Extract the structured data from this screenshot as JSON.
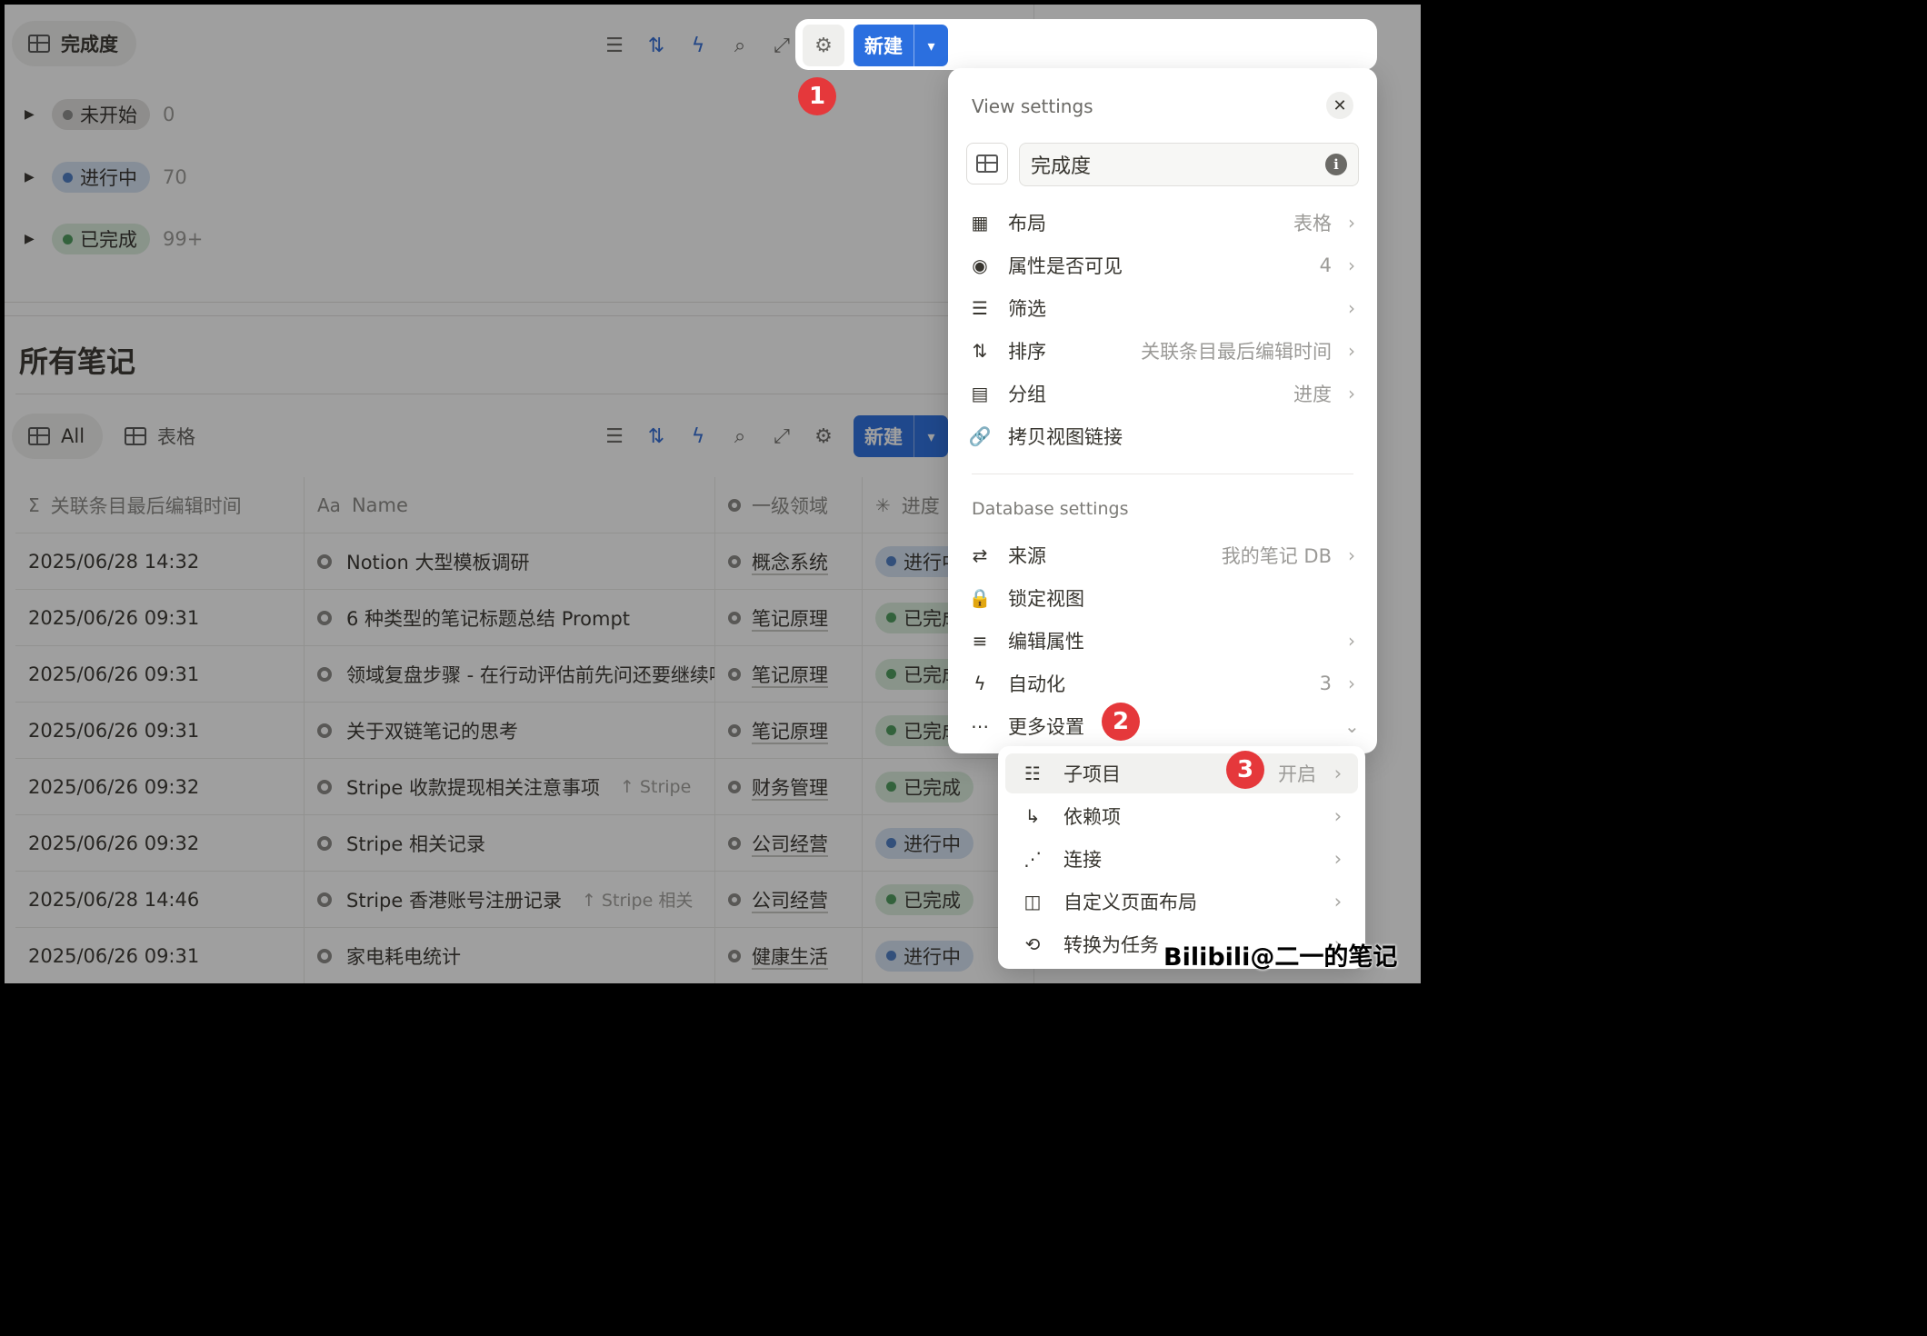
{
  "top_view": {
    "tab_label": "完成度",
    "new_button": "新建",
    "groups": [
      {
        "label": "未开始",
        "count": "0",
        "color": "#8d8d8a",
        "bg": "#e3e2e0"
      },
      {
        "label": "进行中",
        "count": "70",
        "color": "#4b7cc4",
        "bg": "#d6e3f3"
      },
      {
        "label": "已完成",
        "count": "99+",
        "color": "#4c9a5b",
        "bg": "#dbeddd"
      }
    ]
  },
  "section": {
    "title": "所有笔记",
    "tabs": [
      {
        "label": "All"
      },
      {
        "label": "表格"
      }
    ],
    "new_button": "新建"
  },
  "table": {
    "headers": [
      "关联条目最后编辑时间",
      "Name",
      "一级领域",
      "进度"
    ],
    "rows": [
      {
        "time": "2025/06/28 14:32",
        "name": "Notion 大型模板调研",
        "ref": "",
        "domain": "概念系统",
        "status": "进行中"
      },
      {
        "time": "2025/06/26 09:31",
        "name": "6 种类型的笔记标题总结 Prompt",
        "ref": "",
        "domain": "笔记原理",
        "status": "已完成"
      },
      {
        "time": "2025/06/26 09:31",
        "name": "领域复盘步骤 - 在行动评估前先问还要继续吗",
        "ref": "",
        "domain": "笔记原理",
        "status": "已完成"
      },
      {
        "time": "2025/06/26 09:31",
        "name": "关于双链笔记的思考",
        "ref": "",
        "domain": "笔记原理",
        "status": "已完成"
      },
      {
        "time": "2025/06/26 09:32",
        "name": "Stripe 收款提现相关注意事项",
        "ref": "↑ Stripe",
        "domain": "财务管理",
        "status": "已完成"
      },
      {
        "time": "2025/06/26 09:32",
        "name": "Stripe 相关记录",
        "ref": "",
        "domain": "公司经营",
        "status": "进行中"
      },
      {
        "time": "2025/06/28 14:46",
        "name": "Stripe 香港账号注册记录",
        "ref": "↑ Stripe 相关",
        "domain": "公司经营",
        "status": "已完成"
      },
      {
        "time": "2025/06/26 09:31",
        "name": "家电耗电统计",
        "ref": "",
        "domain": "健康生活",
        "status": "进行中"
      }
    ]
  },
  "status_colors": {
    "进行中": {
      "dot": "#4b7cc4",
      "bg": "#d6e3f3"
    },
    "已完成": {
      "dot": "#4c9a5b",
      "bg": "#dbeddd"
    }
  },
  "panel": {
    "title": "View settings",
    "view_name": "完成度",
    "view_items": [
      {
        "icon": "table-icon",
        "glyph": "▦",
        "label": "布局",
        "value": "表格"
      },
      {
        "icon": "eye-icon",
        "glyph": "◉",
        "label": "属性是否可见",
        "value": "4"
      },
      {
        "icon": "filter-icon",
        "glyph": "☰",
        "label": "筛选",
        "value": ""
      },
      {
        "icon": "sort-icon",
        "glyph": "⇅",
        "label": "排序",
        "value": "关联条目最后编辑时间"
      },
      {
        "icon": "group-icon",
        "glyph": "▤",
        "label": "分组",
        "value": "进度"
      },
      {
        "icon": "link-icon",
        "glyph": "🔗",
        "label": "拷贝视图链接",
        "value": ""
      }
    ],
    "db_title": "Database settings",
    "db_items": [
      {
        "icon": "source-icon",
        "glyph": "⇄",
        "label": "来源",
        "value": "我的笔记 DB"
      },
      {
        "icon": "lock-icon",
        "glyph": "🔒",
        "label": "锁定视图",
        "value": ""
      },
      {
        "icon": "list-icon",
        "glyph": "≡",
        "label": "编辑属性",
        "value": ""
      },
      {
        "icon": "bolt-icon",
        "glyph": "ϟ",
        "label": "自动化",
        "value": "3"
      },
      {
        "icon": "more-icon",
        "glyph": "⋯",
        "label": "更多设置",
        "value": ""
      }
    ]
  },
  "submenu": {
    "items": [
      {
        "icon": "sub-items-icon",
        "glyph": "☷",
        "label": "子项目",
        "value": "开启"
      },
      {
        "icon": "dependency-icon",
        "glyph": "↳",
        "label": "依赖项",
        "value": ""
      },
      {
        "icon": "connect-icon",
        "glyph": "⋰",
        "label": "连接",
        "value": ""
      },
      {
        "icon": "layout-icon",
        "glyph": "◫",
        "label": "自定义页面布局",
        "value": ""
      },
      {
        "icon": "convert-icon",
        "glyph": "⟲",
        "label": "转换为任务",
        "value": ""
      }
    ]
  },
  "badges": [
    "1",
    "2",
    "3"
  ],
  "watermark": "Bilibili@二一的笔记"
}
